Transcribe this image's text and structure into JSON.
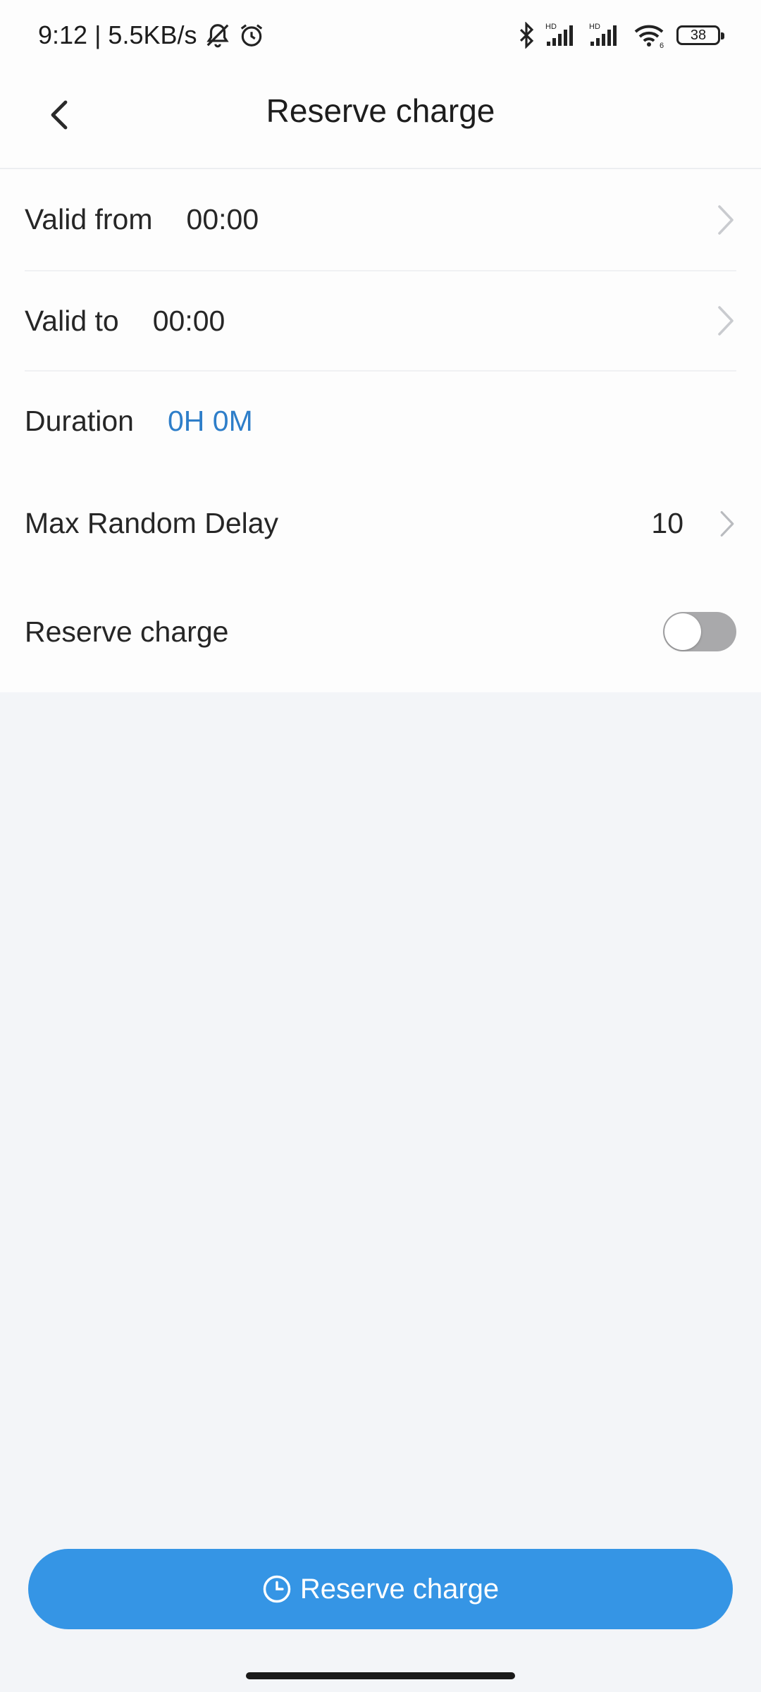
{
  "status_bar": {
    "time_speed": "9:12 | 5.5KB/s",
    "signal_tag_1": "HD",
    "signal_tag_2": "HD",
    "wifi_tag": "6",
    "battery": "38",
    "icons": [
      "bell-muted-icon",
      "alarm-icon",
      "bluetooth-icon",
      "signal-icon",
      "signal-icon",
      "wifi-icon",
      "battery-icon"
    ]
  },
  "header": {
    "title": "Reserve charge",
    "back_icon": "chevron-left-icon"
  },
  "settings": {
    "valid_from": {
      "label": "Valid from",
      "value": "00:00"
    },
    "valid_to": {
      "label": "Valid to",
      "value": "00:00"
    },
    "duration": {
      "label": "Duration",
      "value": "0H 0M"
    },
    "max_random_delay": {
      "label": "Max Random Delay",
      "value": "10"
    },
    "reserve_charge": {
      "label": "Reserve charge",
      "enabled": false
    }
  },
  "action_button": {
    "label": "Reserve charge",
    "icon": "clock-icon"
  },
  "colors": {
    "accent": "#3595e5",
    "duration_text": "#2e7ec9",
    "toggle_off": "#a9a9ab",
    "page_background": "#f3f5f8"
  }
}
